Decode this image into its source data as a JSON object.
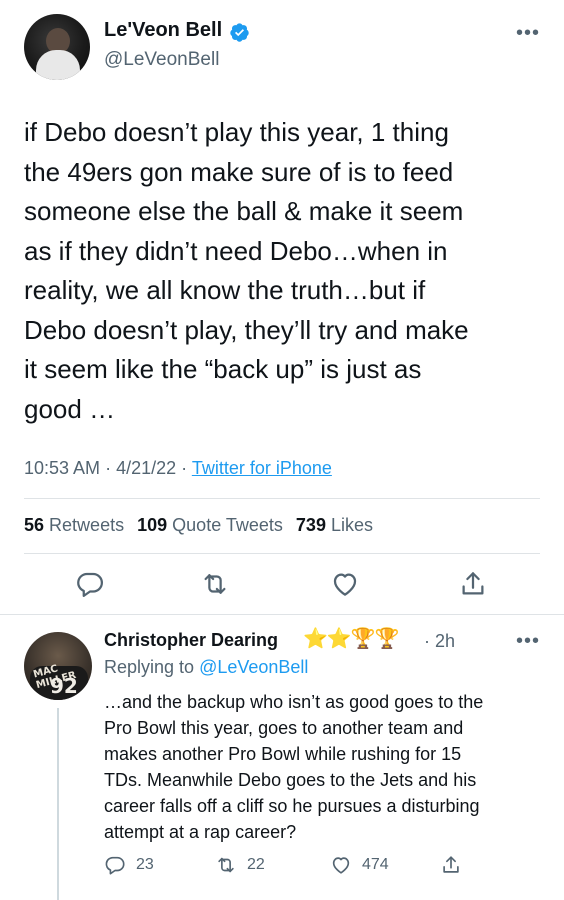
{
  "tweet": {
    "author_name": "Le'Veon Bell",
    "handle": "@LeVeonBell",
    "more_icon": "•••",
    "text": "if Debo doesn’t play this year, 1 thing\nthe 49ers gon make sure of is to feed\nsomeone else the ball & make it seem\nas if they didn’t need Debo…when in\nreality, we all know the truth…but if\nDebo doesn’t play, they’ll try and make\nit seem like the “back up” is just as\ngood …",
    "time": "10:53 AM",
    "date": "4/21/22",
    "source": "Twitter for iPhone",
    "retweets_count": "56",
    "retweets_label": "Retweets",
    "quotes_count": "109",
    "quotes_label": "Quote Tweets",
    "likes_count": "739",
    "likes_label": "Likes"
  },
  "reply": {
    "author_name": "Christopher Dearing",
    "emojis": "⭐⭐🏆🏆",
    "time": "· 2h",
    "more_icon": "•••",
    "replying_prefix": "Replying to",
    "replying_to": "@LeVeonBell",
    "text": "…and the backup who isn’t as good goes to the\nPro Bowl this year, goes to another team and\nmakes another Pro Bowl while rushing for 15\nTDs. Meanwhile Debo goes to the Jets and his\ncareer falls off a cliff so he pursues a disturbing\nattempt at a rap career?",
    "replies_count": "23",
    "retweets_count": "22",
    "likes_count": "474",
    "avatar_text_top": "MAC MILLER",
    "avatar_text_number": "92"
  },
  "colors": {
    "accent": "#1d9bf0",
    "secondary_text": "#536471",
    "primary_text": "#0f1419",
    "divider": "#dfe3e6"
  },
  "icons": [
    "verified-badge-icon",
    "more-icon",
    "reply-icon",
    "retweet-icon",
    "like-icon",
    "share-icon"
  ]
}
